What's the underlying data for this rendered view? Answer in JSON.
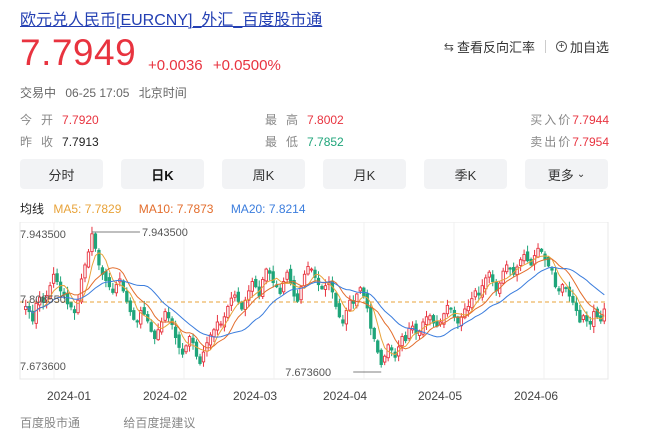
{
  "header": {
    "title": "欧元兑人民币[EURCNY]_外汇_百度股市通",
    "price": "7.7949",
    "change_abs": "+0.0036",
    "change_pct": "+0.0500%",
    "reverse_rate_label": "查看反向汇率",
    "watchlist_label": "加自选"
  },
  "status": {
    "state": "交易中",
    "datetime": "06-25 17:05",
    "timezone": "北京时间"
  },
  "stats": {
    "open_label": "今开",
    "open_value": "7.7920",
    "prev_close_label": "昨收",
    "prev_close_value": "7.7913",
    "high_label": "最高",
    "high_value": "7.8002",
    "low_label": "最低",
    "low_value": "7.7852",
    "bid_label": "买入价",
    "bid_value": "7.7944",
    "ask_label": "卖出价",
    "ask_value": "7.7954"
  },
  "tabs": [
    {
      "label": "分时"
    },
    {
      "label": "日K"
    },
    {
      "label": "周K"
    },
    {
      "label": "月K"
    },
    {
      "label": "季K"
    },
    {
      "label": "更多"
    }
  ],
  "legend": {
    "ma_label": "均线",
    "ma5": "MA5: 7.7829",
    "ma10": "MA10: 7.7873",
    "ma20": "MA20: 7.8214"
  },
  "colors": {
    "up": "#e8333f",
    "down": "#1fa57a",
    "ma5": "#e8a33a",
    "ma10": "#e36d2c",
    "ma20": "#3b7ddd",
    "title": "#2440b3"
  },
  "chart_data": {
    "type": "candlestick",
    "y_axis_labels": [
      "7.943500",
      "7.808550",
      "7.673600"
    ],
    "ylim": [
      7.6736,
      7.9435
    ],
    "reference_line": 7.80855,
    "max_annotation": "7.943500",
    "min_annotation": "7.673600",
    "x_axis_labels": [
      "2024-01",
      "2024-02",
      "2024-03",
      "2024-04",
      "2024-05",
      "2024-06"
    ],
    "closes": [
      7.8,
      7.79,
      7.772,
      7.806,
      7.818,
      7.808,
      7.821,
      7.84,
      7.862,
      7.848,
      7.83,
      7.822,
      7.805,
      7.799,
      7.788,
      7.812,
      7.853,
      7.88,
      7.905,
      7.94,
      7.912,
      7.88,
      7.862,
      7.85,
      7.838,
      7.827,
      7.842,
      7.853,
      7.83,
      7.81,
      7.79,
      7.775,
      7.77,
      7.792,
      7.785,
      7.772,
      7.752,
      7.738,
      7.755,
      7.77,
      7.79,
      7.778,
      7.765,
      7.74,
      7.721,
      7.708,
      7.724,
      7.742,
      7.73,
      7.704,
      7.69,
      7.712,
      7.73,
      7.745,
      7.755,
      7.77,
      7.766,
      7.78,
      7.8,
      7.816,
      7.822,
      7.81,
      7.795,
      7.812,
      7.83,
      7.848,
      7.838,
      7.82,
      7.852,
      7.872,
      7.864,
      7.846,
      7.838,
      7.825,
      7.848,
      7.866,
      7.845,
      7.82,
      7.81,
      7.838,
      7.862,
      7.877,
      7.872,
      7.856,
      7.842,
      7.834,
      7.84,
      7.846,
      7.828,
      7.8,
      7.78,
      7.768,
      7.792,
      7.812,
      7.806,
      7.824,
      7.836,
      7.82,
      7.797,
      7.758,
      7.738,
      7.712,
      7.688,
      7.704,
      7.726,
      7.716,
      7.702,
      7.722,
      7.742,
      7.734,
      7.758,
      7.762,
      7.748,
      7.752,
      7.77,
      7.78,
      7.782,
      7.768,
      7.762,
      7.77,
      7.786,
      7.802,
      7.795,
      7.78,
      7.768,
      7.78,
      7.795,
      7.8,
      7.815,
      7.83,
      7.822,
      7.84,
      7.855,
      7.866,
      7.848,
      7.83,
      7.845,
      7.868,
      7.88,
      7.872,
      7.862,
      7.876,
      7.89,
      7.9,
      7.888,
      7.88,
      7.898,
      7.912,
      7.906,
      7.89,
      7.878,
      7.87,
      7.838,
      7.83,
      7.842,
      7.836,
      7.82,
      7.808,
      7.792,
      7.77,
      7.782,
      7.772,
      7.766,
      7.79,
      7.78,
      7.772,
      7.795
    ]
  },
  "footer": {
    "source": "百度股市通",
    "feedback": "给百度提建议"
  }
}
